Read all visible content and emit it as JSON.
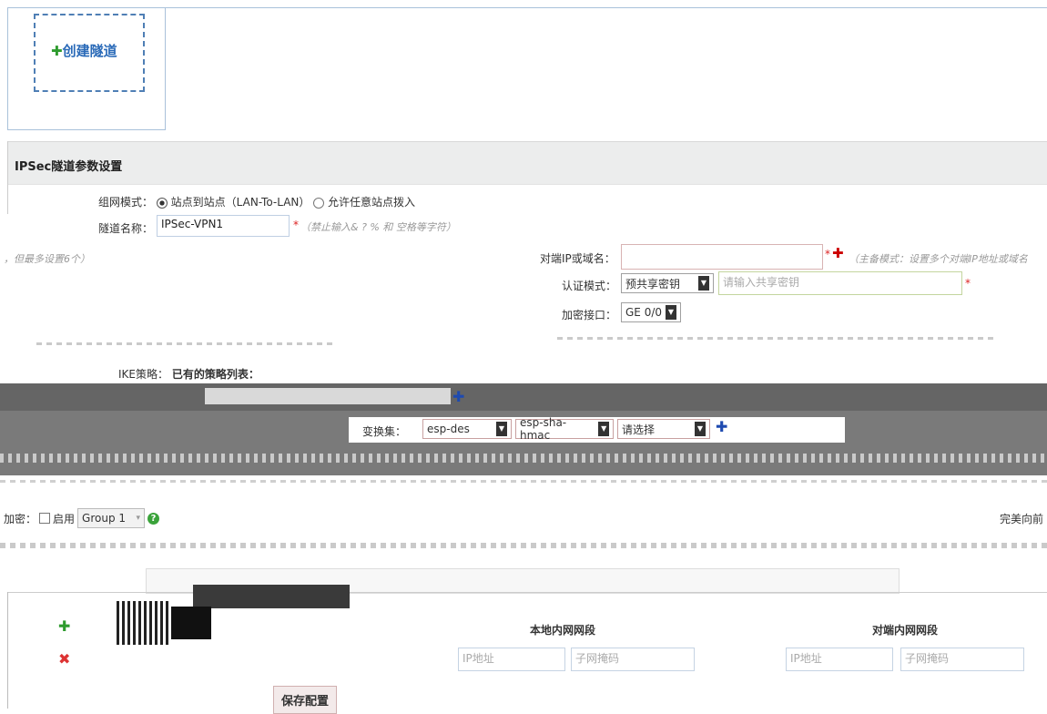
{
  "create_tunnel": {
    "label": "创建隧道"
  },
  "section": {
    "title": "IPSec隧道参数设置"
  },
  "mode": {
    "label": "组网模式：",
    "option1": "站点到站点（LAN-To-LAN）",
    "option2": "允许任意站点拨入"
  },
  "tunnel_name": {
    "label": "隧道名称：",
    "value": "IPSec-VPN1",
    "hint": "（禁止输入& ? % 和 空格等字符）"
  },
  "left_hint": "，但最多设置6个）",
  "peer": {
    "label": "对端IP或域名：",
    "hint": "（主备模式：设置多个对端IP地址或域名"
  },
  "auth": {
    "label": "认证模式：",
    "value": "预共享密钥",
    "placeholder": "请输入共享密钥"
  },
  "interface": {
    "label": "加密接口：",
    "value": "GE 0/0"
  },
  "ike": {
    "label": "IKE策略：",
    "existing": "已有的策略列表："
  },
  "transform": {
    "label": "变换集：",
    "enc": "esp-des",
    "hash": "esp-sha-hmac",
    "select3": "请选择"
  },
  "pfs": {
    "label": "加密：",
    "enable": "启用",
    "group": "Group 1",
    "right_label": "完美向前"
  },
  "networks": {
    "local_header": "本地内网网段",
    "remote_header": "对端内网网段",
    "ip_placeholder": "IP地址",
    "mask_placeholder": "子网掩码"
  },
  "save": {
    "label": "保存配置"
  },
  "colors": {
    "accent": "#2a6ab8",
    "green": "#2e9b2e",
    "red": "#cc0000",
    "blue": "#1e4ab0"
  }
}
